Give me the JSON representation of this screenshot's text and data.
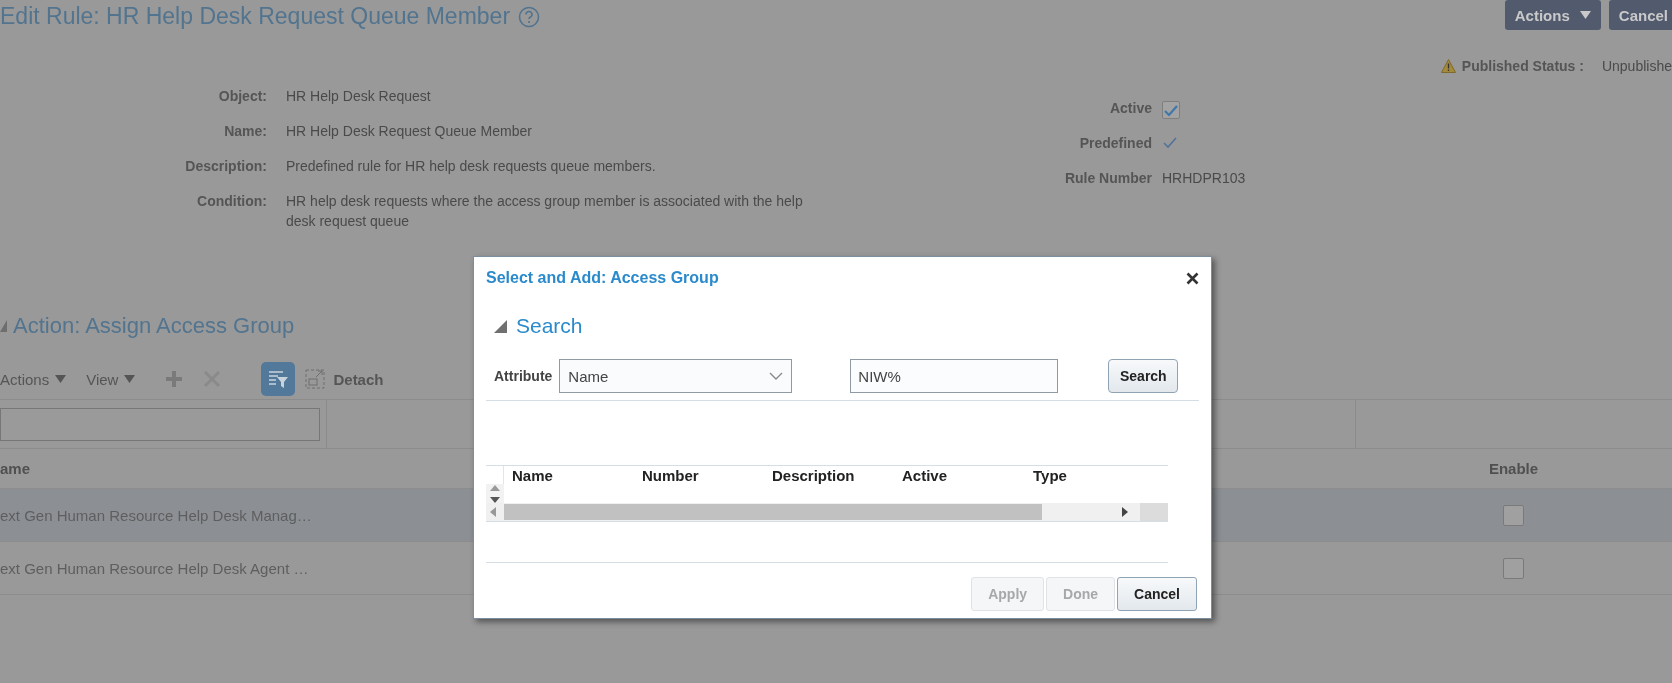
{
  "page": {
    "title": "Edit Rule: HR Help Desk Request Queue Member",
    "header_buttons": [
      {
        "label": "Actions",
        "kind": "menu"
      },
      {
        "label": "Cancel",
        "kind": "plain"
      }
    ],
    "published_status": {
      "label": "Published Status :",
      "value": "Unpublishe"
    },
    "fields": [
      {
        "label": "Object:",
        "value": "HR Help Desk Request"
      },
      {
        "label": "Name:",
        "value": "HR Help Desk Request Queue Member"
      },
      {
        "label": "Description:",
        "value": "Predefined rule for HR help desk requests queue members."
      },
      {
        "label": "Condition:",
        "value": "HR help desk requests where the access group member is associated with the help desk request queue"
      }
    ],
    "flags": [
      {
        "label": "Active",
        "kind": "checkbox",
        "checked": true
      },
      {
        "label": "Predefined",
        "kind": "readonly-check",
        "checked": true
      },
      {
        "label": "Rule Number",
        "kind": "text",
        "value": "HRHDPR103"
      }
    ],
    "action_section": {
      "title": "Action: Assign Access Group",
      "expanded": true,
      "toolbar": {
        "menus": [
          "Actions",
          "View"
        ],
        "detach": "Detach"
      },
      "table": {
        "columns": [
          "ame",
          "Enable"
        ],
        "rows": [
          {
            "name": "ext Gen Human Resource Help Desk Manag…",
            "enabled": false,
            "selected": true
          },
          {
            "name": "ext Gen Human Resource Help Desk Agent …",
            "enabled": false,
            "selected": false
          }
        ]
      }
    }
  },
  "dialog": {
    "title": "Select and Add: Access Group",
    "search": {
      "title": "Search",
      "expanded": true,
      "attribute_label": "Attribute",
      "attribute_value": "Name",
      "query": "NIW%",
      "button": "Search"
    },
    "results": {
      "columns": [
        "Name",
        "Number",
        "Description",
        "Active",
        "Type"
      ]
    },
    "buttons": [
      {
        "label": "Apply",
        "disabled": true
      },
      {
        "label": "Done",
        "disabled": true
      },
      {
        "label": "Cancel",
        "disabled": false
      }
    ]
  }
}
